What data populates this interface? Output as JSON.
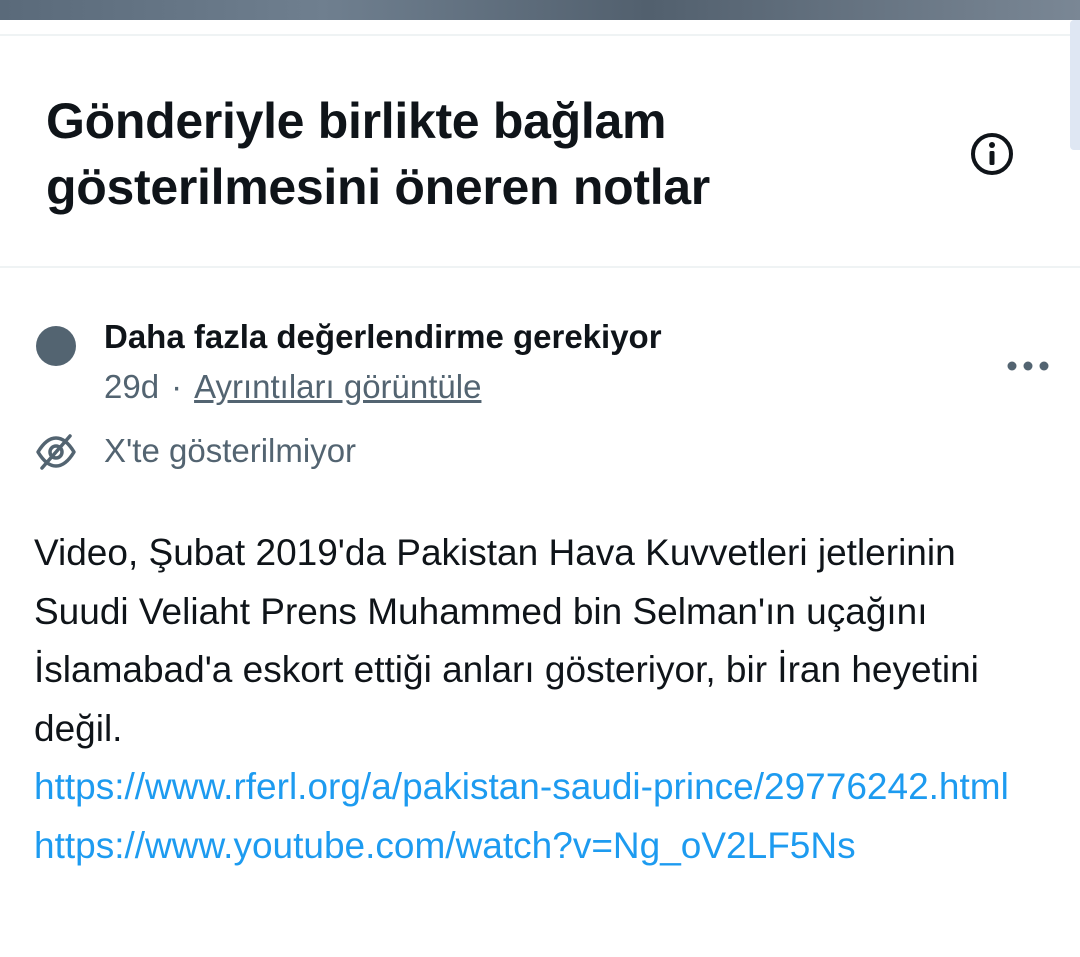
{
  "header": {
    "title": "Gönderiyle birlikte bağlam gösterilmesini öneren notlar",
    "info_icon": "info-circle-icon"
  },
  "note": {
    "status": "Daha fazla değerlendirme gerekiyor",
    "status_color": "#536471",
    "age": "29d",
    "separator": "·",
    "details_link": "Ayrıntıları görüntüle",
    "more_icon": "more-horizontal-icon",
    "visibility_icon": "eye-off-icon",
    "visibility_text": "X'te gösterilmiyor",
    "body": "Video, Şubat 2019'da Pakistan Hava Kuvvetleri jetlerinin Suudi Veliaht Prens Muhammed bin Selman'ın uçağını İslamabad'a eskort ettiği anları gösteriyor, bir İran heyetini değil.",
    "links": [
      "https://www.rferl.org/a/pakistan-saudi-prince/29776242.html",
      "https://www.youtube.com/watch?v=Ng_oV2LF5Ns"
    ],
    "link_color": "#1d9bf0"
  }
}
